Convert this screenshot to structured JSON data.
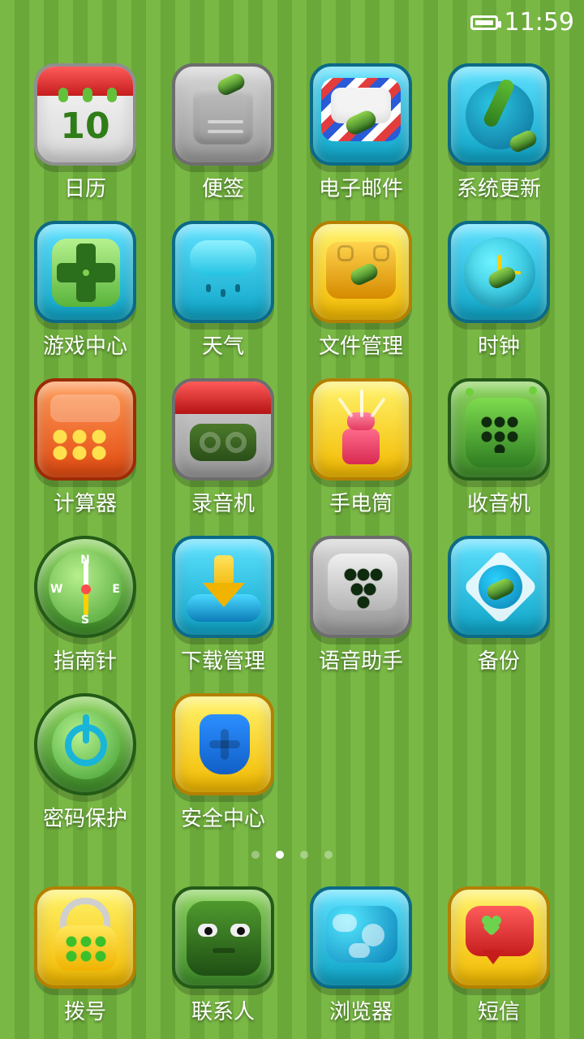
{
  "status_bar": {
    "time": "11:59",
    "battery_icon": "battery-icon"
  },
  "page_dots": {
    "count": 4,
    "active_index": 1
  },
  "apps": [
    {
      "label": "日历",
      "icon": "calendar-icon",
      "icon_text": "10",
      "theme": "white"
    },
    {
      "label": "便签",
      "icon": "notes-icon",
      "theme": "gray"
    },
    {
      "label": "电子邮件",
      "icon": "mail-icon",
      "theme": "blue"
    },
    {
      "label": "系统更新",
      "icon": "system-update-icon",
      "theme": "blue"
    },
    {
      "label": "游戏中心",
      "icon": "game-center-icon",
      "theme": "blue"
    },
    {
      "label": "天气",
      "icon": "weather-icon",
      "theme": "blue"
    },
    {
      "label": "文件管理",
      "icon": "file-manager-icon",
      "theme": "yellow"
    },
    {
      "label": "时钟",
      "icon": "clock-icon",
      "theme": "blue"
    },
    {
      "label": "计算器",
      "icon": "calculator-icon",
      "theme": "orange"
    },
    {
      "label": "录音机",
      "icon": "recorder-icon",
      "theme": "gray"
    },
    {
      "label": "手电筒",
      "icon": "flashlight-icon",
      "theme": "yellow"
    },
    {
      "label": "收音机",
      "icon": "radio-icon",
      "theme": "green"
    },
    {
      "label": "指南针",
      "icon": "compass-icon",
      "theme": "green",
      "compass_letters": [
        "N",
        "W",
        "E",
        "S"
      ]
    },
    {
      "label": "下载管理",
      "icon": "download-manager-icon",
      "theme": "blue"
    },
    {
      "label": "语音助手",
      "icon": "voice-assistant-icon",
      "theme": "gray"
    },
    {
      "label": "备份",
      "icon": "backup-icon",
      "theme": "blue"
    },
    {
      "label": "密码保护",
      "icon": "password-protection-icon",
      "theme": "green"
    },
    {
      "label": "安全中心",
      "icon": "security-center-icon",
      "theme": "yellow"
    }
  ],
  "dock": [
    {
      "label": "拨号",
      "icon": "dialer-icon",
      "theme": "yellow"
    },
    {
      "label": "联系人",
      "icon": "contacts-icon",
      "theme": "green"
    },
    {
      "label": "浏览器",
      "icon": "browser-icon",
      "theme": "blue"
    },
    {
      "label": "短信",
      "icon": "messages-icon",
      "theme": "yellow"
    }
  ]
}
